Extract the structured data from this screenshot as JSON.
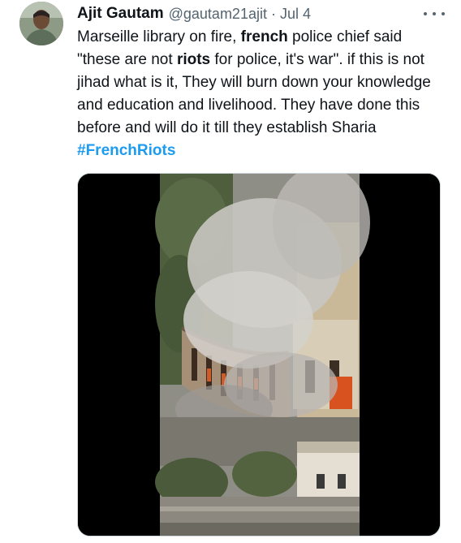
{
  "tweet": {
    "display_name": "Ajit Gautam",
    "handle": "@gautam21ajit",
    "separator": "·",
    "timestamp": "Jul 4",
    "more_icon": "more-horizontal-icon",
    "text": {
      "t1": "Marseille library on fire, ",
      "b1": "french",
      "t2": " police chief said \"these are not ",
      "b2": "riots",
      "t3": " for police, it's war\". if this is not jihad what is it, They will burn down your knowledge and education and livelihood. They have done this before and will do it till they establish Sharia ",
      "hashtag": "#FrenchRiots"
    }
  },
  "colors": {
    "text": "#0f1419",
    "secondary": "#536471",
    "link": "#1d9bf0"
  }
}
